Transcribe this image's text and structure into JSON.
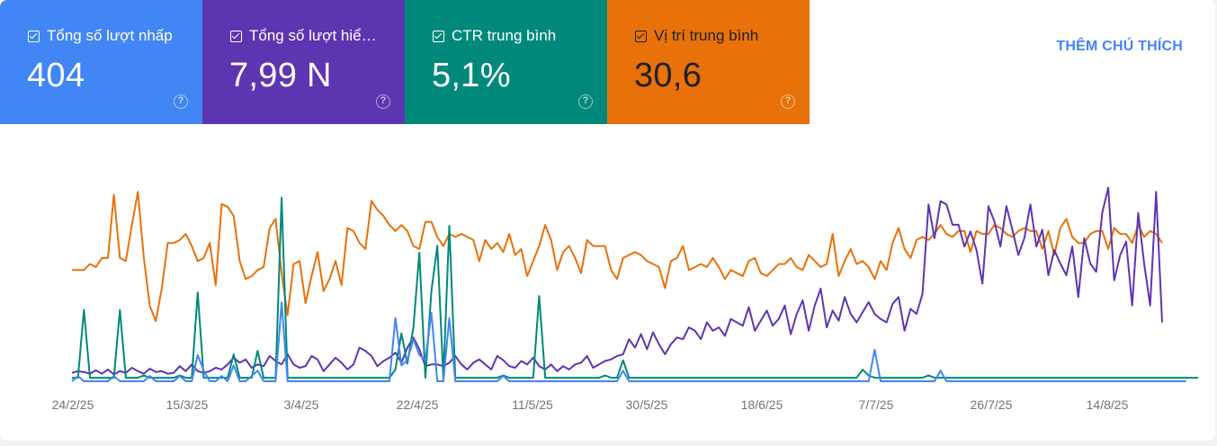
{
  "metrics": [
    {
      "label": "Tổng số lượt nhấp",
      "value": "404",
      "color": "#4285f4",
      "checked": true
    },
    {
      "label": "Tổng số lượt hiể…",
      "value": "7,99 N",
      "color": "#5e35b1",
      "checked": true
    },
    {
      "label": "CTR trung bình",
      "value": "5,1%",
      "color": "#00897b",
      "checked": true
    },
    {
      "label": "Vị trí trung bình",
      "value": "30,6",
      "color": "#e8710a",
      "checked": true
    }
  ],
  "help_icon": "help-circle-icon",
  "annotation_button": "THÊM CHÚ THÍCH",
  "chart_data": {
    "type": "line",
    "x_ticks": [
      "24/2/25",
      "15/3/25",
      "3/4/25",
      "22/4/25",
      "11/5/25",
      "30/5/25",
      "18/6/25",
      "7/7/25",
      "26/7/25",
      "14/8/25"
    ],
    "x_start": "24/2/25",
    "num_days": 183,
    "grid": false,
    "legend": "none",
    "y_scale": "independent per series (no y axis shown)",
    "series": [
      {
        "name": "Vị trí trung bình",
        "color": "#e8710a",
        "scale_max": 70,
        "values": [
          37,
          37,
          37,
          39,
          38,
          41,
          41,
          62,
          41,
          40,
          52,
          63,
          41,
          25,
          20,
          31,
          46,
          46,
          47,
          49,
          45,
          40,
          41,
          46,
          32,
          59,
          58,
          55,
          40,
          34,
          35,
          37,
          38,
          51,
          54,
          36,
          22,
          39,
          40,
          26,
          35,
          43,
          30,
          34,
          40,
          32,
          51,
          50,
          46,
          44,
          60,
          57,
          55,
          52,
          50,
          52,
          50,
          45,
          44,
          53,
          53,
          48,
          45,
          49,
          48,
          49,
          48,
          47,
          40,
          47,
          44,
          46,
          43,
          49,
          42,
          44,
          35,
          40,
          45,
          52,
          47,
          37,
          43,
          45,
          41,
          36,
          47,
          45,
          45,
          45,
          37,
          34,
          41,
          42,
          43,
          42,
          40,
          39,
          38,
          31,
          40,
          41,
          45,
          37,
          38,
          39,
          38,
          41,
          38,
          34,
          37,
          36,
          35,
          40,
          41,
          36,
          35,
          37,
          39,
          39,
          41,
          38,
          37,
          42,
          40,
          38,
          39,
          49,
          35,
          40,
          44,
          39,
          40,
          38,
          34,
          40,
          37,
          46,
          51,
          44,
          41,
          47,
          48,
          47,
          49,
          52,
          49,
          48,
          50,
          50,
          43,
          50,
          49,
          49,
          52,
          51,
          49,
          48,
          50,
          51,
          50,
          50,
          44,
          50,
          42,
          51,
          54,
          48,
          46,
          46,
          49,
          50,
          50,
          44,
          51,
          49,
          49,
          46,
          52,
          48,
          50,
          49,
          46
        ]
      },
      {
        "name": "Tổng số lượt hiể…",
        "color": "#5e35b1",
        "scale_max": 250,
        "values": [
          10,
          12,
          11,
          9,
          13,
          9,
          14,
          8,
          12,
          10,
          16,
          12,
          9,
          15,
          11,
          12,
          9,
          10,
          18,
          12,
          20,
          12,
          10,
          12,
          16,
          14,
          20,
          28,
          22,
          26,
          16,
          20,
          18,
          30,
          24,
          20,
          32,
          20,
          16,
          18,
          30,
          26,
          12,
          20,
          28,
          22,
          14,
          20,
          40,
          36,
          30,
          18,
          24,
          28,
          34,
          22,
          40,
          52,
          38,
          18,
          20,
          20,
          18,
          22,
          30,
          20,
          14,
          22,
          26,
          20,
          14,
          30,
          25,
          18,
          16,
          24,
          20,
          28,
          18,
          14,
          20,
          12,
          18,
          14,
          20,
          22,
          30,
          16,
          20,
          24,
          26,
          30,
          32,
          50,
          40,
          56,
          38,
          58,
          44,
          32,
          44,
          52,
          50,
          64,
          60,
          50,
          70,
          60,
          64,
          54,
          74,
          70,
          66,
          88,
          60,
          72,
          84,
          66,
          74,
          90,
          56,
          80,
          96,
          60,
          90,
          110,
          64,
          84,
          72,
          100,
          80,
          70,
          82,
          94,
          80,
          74,
          70,
          92,
          100,
          60,
          86,
          80,
          104,
          210,
          170,
          214,
          210,
          186,
          186,
          160,
          178,
          156,
          116,
          208,
          190,
          160,
          208,
          180,
          150,
          170,
          210,
          160,
          180,
          126,
          156,
          140,
          126,
          160,
          100,
          170,
          140,
          130,
          200,
          230,
          120,
          150,
          166,
          90,
          200,
          140,
          90,
          225,
          70
        ]
      },
      {
        "name": "CTR trung bình",
        "color": "#00897b",
        "scale_max": 18,
        "values": [
          0.3,
          0.3,
          6.1,
          0.3,
          0.3,
          0.3,
          0.3,
          0.3,
          6.1,
          0.3,
          0.3,
          0.3,
          0.5,
          0.3,
          0.3,
          0.3,
          0.3,
          0.3,
          0.5,
          0.3,
          0.3,
          7.6,
          0.3,
          0.3,
          0.3,
          0.3,
          0.3,
          2.3,
          0.3,
          0.3,
          0.3,
          2.6,
          0.3,
          0.3,
          0.3,
          15.7,
          0.3,
          0.3,
          0.3,
          0.3,
          0.3,
          0.3,
          0.3,
          0.3,
          0.3,
          0.3,
          0.3,
          0.3,
          0.3,
          0.3,
          0.3,
          0.3,
          0.3,
          0.3,
          1.0,
          4.1,
          1.5,
          4.6,
          11.0,
          0.3,
          7.7,
          11.6,
          0.3,
          13.3,
          0.3,
          0.3,
          0.3,
          0.3,
          0.3,
          0.3,
          0.3,
          0.3,
          0.5,
          0.3,
          0.3,
          0.3,
          0.3,
          0.3,
          7.3,
          0.3,
          0.3,
          0.3,
          0.3,
          0.3,
          0.3,
          0.3,
          0.3,
          0.3,
          0.3,
          0.5,
          0.3,
          0.3,
          1.8,
          0.3,
          0.3,
          0.3,
          0.3,
          0.3,
          0.3,
          0.3,
          0.3,
          0.3,
          0.3,
          0.3,
          0.3,
          0.3,
          0.3,
          0.3,
          0.3,
          0.3,
          0.3,
          0.3,
          0.3,
          0.3,
          0.3,
          0.3,
          0.3,
          0.3,
          0.3,
          0.3,
          0.3,
          0.3,
          0.3,
          0.3,
          0.3,
          0.3,
          0.3,
          0.3,
          0.3,
          0.3,
          0.3,
          0.3,
          1.0,
          0.5,
          0.3,
          0.3,
          0.3,
          0.3,
          0.3,
          0.3,
          0.3,
          0.3,
          0.3,
          0.5,
          0.3,
          0.3,
          0.3,
          0.3,
          0.3,
          0.3,
          0.3,
          0.3,
          0.3,
          0.3,
          0.3,
          0.3,
          0.3,
          0.3,
          0.3,
          0.3,
          0.3,
          0.3,
          0.3,
          0.3,
          0.3,
          0.3,
          0.3,
          0.3,
          0.3,
          0.3,
          0.3,
          0.3,
          0.3,
          0.3,
          0.3,
          0.3,
          0.3,
          0.3,
          0.3,
          0.3,
          0.3,
          0.3,
          0.3,
          0.3,
          0.3,
          0.3,
          0.3,
          0.3,
          0.3
        ]
      },
      {
        "name": "Tổng số lượt nhấp",
        "color": "#4285f4",
        "scale_max": 40,
        "values": [
          0,
          1,
          0,
          0,
          0,
          0,
          0,
          1,
          0,
          0,
          0,
          0,
          0,
          1,
          0,
          0,
          0,
          0,
          1,
          0,
          0,
          5,
          2,
          0,
          0,
          1,
          0,
          3,
          0,
          0,
          1,
          2,
          0,
          0,
          0,
          15,
          0,
          0,
          0,
          0,
          0,
          0,
          0,
          0,
          0,
          0,
          0,
          0,
          0,
          0,
          0,
          0,
          0,
          0,
          12,
          3,
          4,
          8,
          5,
          4,
          13,
          0,
          0,
          12,
          0,
          0,
          0,
          0,
          0,
          0,
          0,
          0,
          1,
          0,
          0,
          0,
          0,
          0,
          0,
          0,
          0,
          0,
          0,
          0,
          0,
          0,
          0,
          0,
          0,
          0,
          0,
          0,
          2,
          0,
          0,
          0,
          0,
          0,
          0,
          0,
          0,
          0,
          0,
          0,
          0,
          0,
          0,
          0,
          0,
          0,
          0,
          0,
          0,
          0,
          0,
          0,
          0,
          0,
          0,
          0,
          0,
          0,
          0,
          0,
          0,
          0,
          0,
          0,
          0,
          0,
          0,
          0,
          0,
          0,
          6,
          0,
          0,
          0,
          0,
          0,
          0,
          0,
          0,
          0,
          0,
          2,
          0,
          0,
          0,
          0,
          0,
          0,
          0,
          0,
          0,
          0,
          0,
          0,
          0,
          0,
          0,
          0,
          0,
          0,
          0,
          0,
          0,
          0,
          0,
          0,
          0,
          0,
          0,
          0,
          0,
          0,
          0,
          0,
          0,
          0,
          0,
          0,
          0,
          0,
          0,
          0,
          0
        ]
      }
    ]
  }
}
